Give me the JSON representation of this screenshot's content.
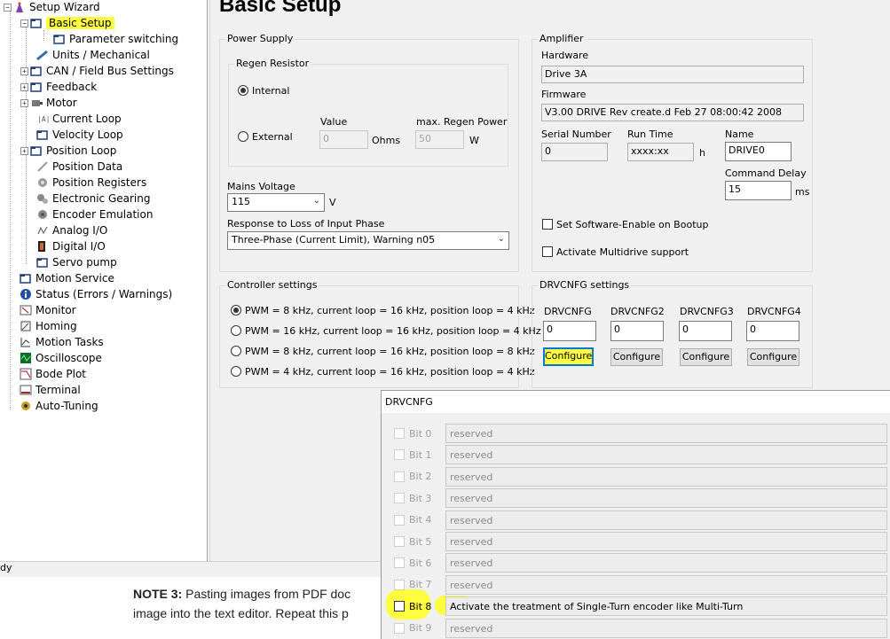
{
  "tree": {
    "items": [
      {
        "label": "Setup Wizard",
        "icon": "wizard-icon"
      },
      {
        "label": "Basic Setup",
        "icon": "folder-icon"
      },
      {
        "label": "Parameter switching",
        "icon": "folder-icon"
      },
      {
        "label": "Units / Mechanical",
        "icon": "ruler-icon"
      },
      {
        "label": "CAN / Field Bus Settings",
        "icon": "folder-icon"
      },
      {
        "label": "Feedback",
        "icon": "folder-icon"
      },
      {
        "label": "Motor",
        "icon": "motor-icon"
      },
      {
        "label": "Current Loop",
        "icon": "current-icon"
      },
      {
        "label": "Velocity Loop",
        "icon": "folder-icon"
      },
      {
        "label": "Position Loop",
        "icon": "folder-icon"
      },
      {
        "label": "Position Data",
        "icon": "position-data-icon"
      },
      {
        "label": "Position Registers",
        "icon": "registers-icon"
      },
      {
        "label": "Electronic Gearing",
        "icon": "gears-icon"
      },
      {
        "label": "Encoder Emulation",
        "icon": "encoder-icon"
      },
      {
        "label": "Analog I/O",
        "icon": "analog-icon"
      },
      {
        "label": "Digital I/O",
        "icon": "digital-io-icon"
      },
      {
        "label": "Servo pump",
        "icon": "folder-icon"
      },
      {
        "label": "Motion Service",
        "icon": "folder-icon"
      },
      {
        "label": "Status (Errors / Warnings)",
        "icon": "info-icon"
      },
      {
        "label": "Monitor",
        "icon": "monitor-icon"
      },
      {
        "label": "Homing",
        "icon": "homing-icon"
      },
      {
        "label": "Motion Tasks",
        "icon": "motion-tasks-icon"
      },
      {
        "label": "Oscilloscope",
        "icon": "oscilloscope-icon"
      },
      {
        "label": "Bode Plot",
        "icon": "bode-icon"
      },
      {
        "label": "Terminal",
        "icon": "terminal-icon"
      },
      {
        "label": "Auto-Tuning",
        "icon": "tuning-icon"
      }
    ]
  },
  "main": {
    "title": "Basic Setup",
    "power_supply": {
      "label": "Power Supply",
      "regen": {
        "label": "Regen Resistor",
        "internal": "Internal",
        "external": "External",
        "value_label": "Value",
        "value": "0",
        "value_unit": "Ohms",
        "max_label": "max. Regen Power",
        "max_value": "50",
        "max_unit": "W"
      },
      "mains_label": "Mains Voltage",
      "mains_value": "115",
      "mains_unit": "V",
      "phase_label": "Response to Loss of Input Phase",
      "phase_value": "Three-Phase (Current Limit), Warning n05"
    },
    "amplifier": {
      "label": "Amplifier",
      "hardware_label": "Hardware",
      "hardware": "Drive 3A",
      "firmware_label": "Firmware",
      "firmware": "V3.00 DRIVE Rev create.d Feb 27 08:00:42 2008",
      "serial_label": "Serial Number",
      "serial": "0",
      "runtime_label": "Run Time",
      "runtime": "xxxx:xx",
      "runtime_unit": "h",
      "name_label": "Name",
      "name": "DRIVE0",
      "delay_label": "Command Delay",
      "delay": "15",
      "delay_unit": "ms",
      "enable_boot": "Set Software-Enable on Bootup",
      "multidrive": "Activate Multidrive support"
    },
    "controller": {
      "label": "Controller settings",
      "options": [
        "PWM = 8 kHz,   current loop = 16 kHz, position loop = 4 kHz",
        "PWM = 16 kHz,  current loop = 16 kHz, position loop = 4 kHz",
        "PWM = 8 kHz,   current loop = 16 kHz, position loop = 8 kHz",
        "PWM = 4 kHz,   current loop = 16 kHz, position loop = 4 kHz"
      ]
    },
    "drvcnfg": {
      "label": "DRVCNFG settings",
      "fields": [
        {
          "label": "DRVCNFG",
          "value": "0"
        },
        {
          "label": "DRVCNFG2",
          "value": "0"
        },
        {
          "label": "DRVCNFG3",
          "value": "0"
        },
        {
          "label": "DRVCNFG4",
          "value": "0"
        }
      ],
      "button": "Configure"
    }
  },
  "status_text": "dy",
  "note": {
    "bold": "NOTE 3:",
    "line1": " Pasting images from PDF doc",
    "line2": "image into the text editor. Repeat this p"
  },
  "popup": {
    "title": "DRVCNFG",
    "bits": [
      {
        "bit": "Bit 0",
        "desc": "reserved"
      },
      {
        "bit": "Bit 1",
        "desc": "reserved"
      },
      {
        "bit": "Bit 2",
        "desc": "reserved"
      },
      {
        "bit": "Bit 3",
        "desc": "reserved"
      },
      {
        "bit": "Bit 4",
        "desc": "reserved"
      },
      {
        "bit": "Bit 5",
        "desc": "reserved"
      },
      {
        "bit": "Bit 6",
        "desc": "reserved"
      },
      {
        "bit": "Bit 7",
        "desc": "reserved"
      },
      {
        "bit": "Bit 8",
        "desc": "Activate the treatment of Single-Turn encoder like Multi-Turn"
      },
      {
        "bit": "Bit 9",
        "desc": "reserved"
      }
    ]
  },
  "colors": {
    "highlight": "#ffff40",
    "focus": "#0078d7",
    "panel": "#f0f0f0"
  }
}
